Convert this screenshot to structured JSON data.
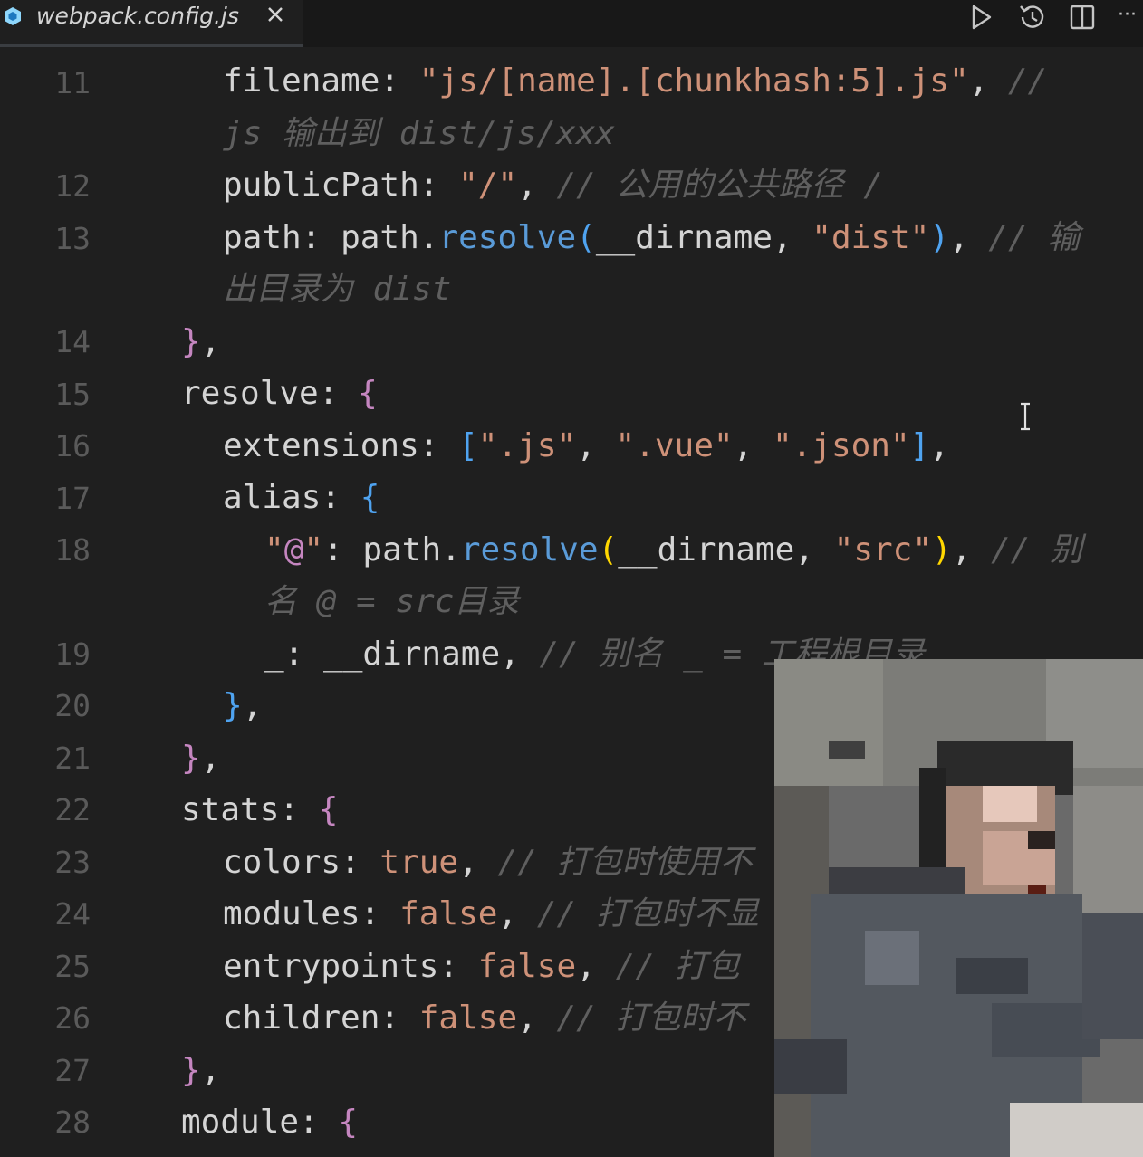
{
  "tab": {
    "filename": "webpack.config.js",
    "close_glyph": "✕"
  },
  "toolbar": {
    "run_icon": "play-icon",
    "history_icon": "history-icon",
    "split_icon": "split-editor-icon",
    "more_label": "···"
  },
  "editor": {
    "line_numbers": [
      "11",
      "12",
      "13",
      "14",
      "15",
      "16",
      "17",
      "18",
      "19",
      "20",
      "21",
      "22",
      "23",
      "24",
      "25",
      "26",
      "27",
      "28"
    ],
    "lines": {
      "l11_key": "filename",
      "l11_value": "\"js/[name].[chunkhash:5].js\"",
      "l11_comment_a": "//",
      "l11_comment_b": "js 输出到 dist/js/xxx",
      "l12_key": "publicPath",
      "l12_value": "\"/\"",
      "l12_comment": "// 公用的公共路径 /",
      "l13_key": "path",
      "l13_obj": "path",
      "l13_fn": "resolve",
      "l13_arg1": "__dirname",
      "l13_arg2": "\"dist\"",
      "l13_comment_a": "// 输",
      "l13_comment_b": "出目录为 dist",
      "l15_key": "resolve",
      "l16_key": "extensions",
      "l16_v1": "\".js\"",
      "l16_v2": "\".vue\"",
      "l16_v3": "\".json\"",
      "l17_key": "alias",
      "l18_at_q1": "\"",
      "l18_at": "@",
      "l18_at_q2": "\"",
      "l18_obj": "path",
      "l18_fn": "resolve",
      "l18_arg1": "__dirname",
      "l18_arg2": "\"src\"",
      "l18_comment_a": "// 别",
      "l18_comment_b": "名 @ = src目录",
      "l19_key": "_",
      "l19_value": "__dirname",
      "l19_comment": "// 别名 _ = 工程根目录",
      "l22_key": "stats",
      "l23_key": "colors",
      "l23_value": "true",
      "l23_comment": "// 打包时使用不",
      "l24_key": "modules",
      "l24_value": "false",
      "l24_comment": "// 打包时不显",
      "l25_key": "entrypoints",
      "l25_value": "false",
      "l25_comment": "// 打包",
      "l26_key": "children",
      "l26_value": "false",
      "l26_comment": "// 打包时不",
      "l28_key": "module"
    }
  },
  "colors": {
    "background": "#1f1f1f",
    "string": "#ce9178",
    "function": "#5a9bd8",
    "comment": "#5f5f5f",
    "bracket_pink": "#c586c0",
    "bracket_blue": "#4fa3f0"
  },
  "webcam": {
    "description_icon": "webcam-overlay"
  }
}
